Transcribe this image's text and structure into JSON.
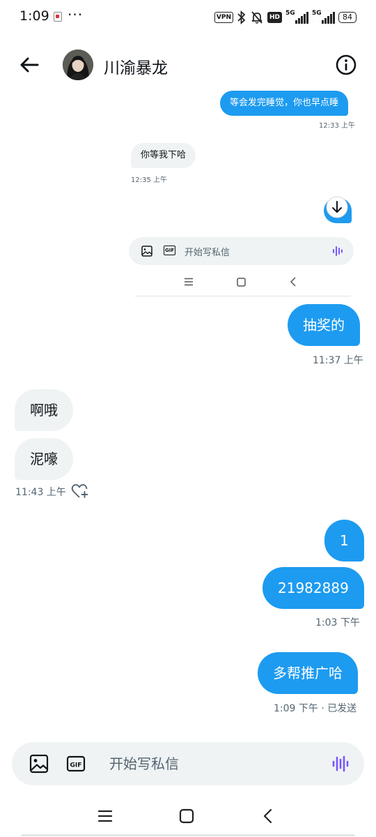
{
  "status_bar": {
    "time": "1:09",
    "more": "···",
    "vpn": "VPN",
    "hd": "HD",
    "network1": "5G",
    "network2": "5G",
    "battery": "84"
  },
  "header": {
    "title": "川渝暴龙"
  },
  "embedded_screenshot": {
    "messages": [
      {
        "dir": "out",
        "text": "等会发完睡觉，你也早点睡",
        "time": "12:33 上午"
      },
      {
        "dir": "in",
        "text": "你等我下哈",
        "time": "12:35 上午"
      }
    ],
    "compose_placeholder": "开始写私信"
  },
  "messages": [
    {
      "dir": "out",
      "text": "抽奖的",
      "time": "11:37 上午"
    },
    {
      "dir": "in",
      "text": "啊哦"
    },
    {
      "dir": "in",
      "text": "泥嚎",
      "time": "11:43 上午"
    },
    {
      "dir": "out",
      "text": "1"
    },
    {
      "dir": "out",
      "text": "21982889",
      "time": "1:03 下午"
    },
    {
      "dir": "out",
      "text": "多帮推广哈",
      "time": "1:09 下午 · 已发送"
    }
  ],
  "compose": {
    "placeholder": "开始写私信",
    "value": ""
  },
  "colors": {
    "accent": "#1d9bf0",
    "incoming_bubble": "#eff3f4",
    "voice_icon": "#7856ff"
  },
  "icons": [
    "back-arrow-icon",
    "info-icon",
    "image-icon",
    "gif-icon",
    "voice-wave-icon",
    "reaction-heart-icon",
    "scroll-down-icon",
    "menu-icon",
    "home-icon",
    "back-nav-icon"
  ]
}
